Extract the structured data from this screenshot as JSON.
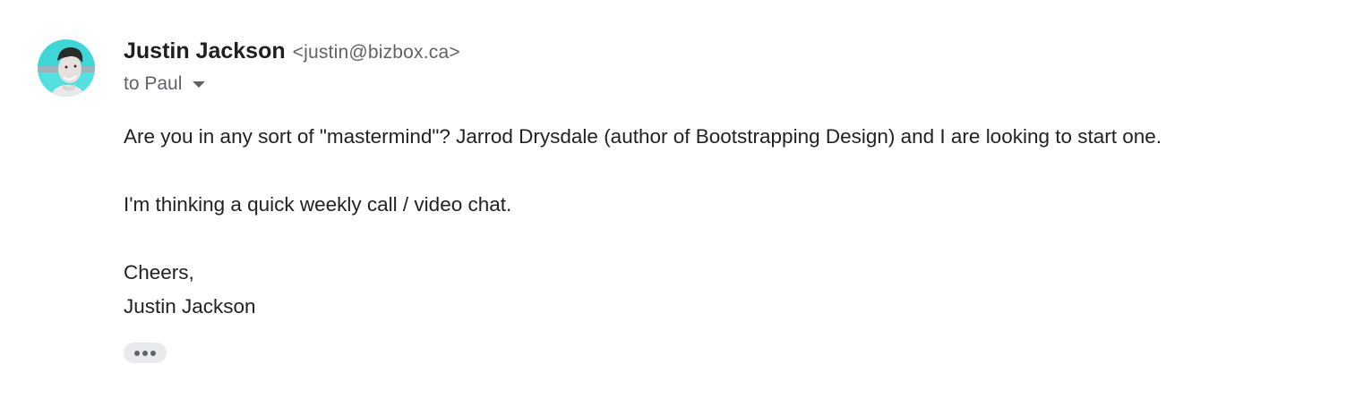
{
  "sender": {
    "name": "Justin Jackson",
    "email": "<justin@bizbox.ca>"
  },
  "recipients": {
    "label": "to Paul"
  },
  "message": {
    "paragraph_1": "Are you in any sort of \"mastermind\"? Jarrod Drysdale (author of Bootstrapping Design) and I are looking to start one.",
    "paragraph_2": "I'm thinking a quick weekly call / video chat.",
    "closing": "Cheers,",
    "signature": "Justin Jackson"
  },
  "icons": {
    "avatar": "profile-photo",
    "recipient_dropdown": "chevron-down-icon",
    "trimmed_content": "more-horizontal-icon"
  },
  "colors": {
    "avatar_background": "#3fd6d8",
    "more_button_background": "#e8eaed",
    "secondary_text": "#5f6368"
  }
}
